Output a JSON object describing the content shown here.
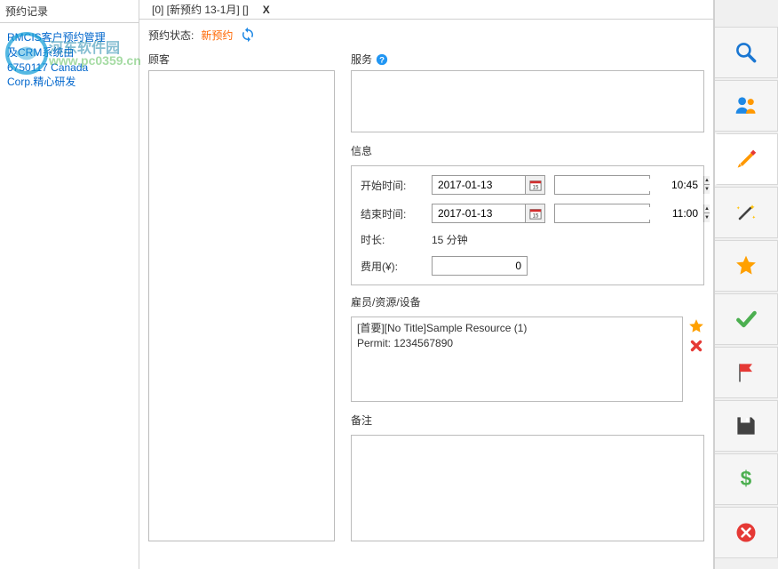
{
  "watermark": {
    "text": "河东软件园",
    "url": "www.pc0359.cn"
  },
  "left": {
    "header": "预约记录",
    "lines": [
      "RMCIS客户预约管理",
      "及CRM系统由",
      "6750117 Canada",
      "Corp.精心研发"
    ]
  },
  "tabs": {
    "main": "[0] [新预约 13-1月] []",
    "close": "X"
  },
  "status": {
    "label": "预约状态:",
    "value": "新预约"
  },
  "customer": {
    "label": "顾客"
  },
  "service": {
    "label": "服务"
  },
  "info": {
    "header": "信息",
    "start_label": "开始时间:",
    "start_date": "2017-01-13",
    "start_time": "10:45",
    "end_label": "结束时间:",
    "end_date": "2017-01-13",
    "end_time": "11:00",
    "duration_label": "时长:",
    "duration_value": "15 分钟",
    "fee_label": "费用(¥):",
    "fee_value": "0"
  },
  "resource": {
    "header": "雇员/资源/设备",
    "line1": "[首要][No Title]Sample Resource (1)",
    "line2": "Permit: 1234567890"
  },
  "notes": {
    "header": "备注"
  }
}
